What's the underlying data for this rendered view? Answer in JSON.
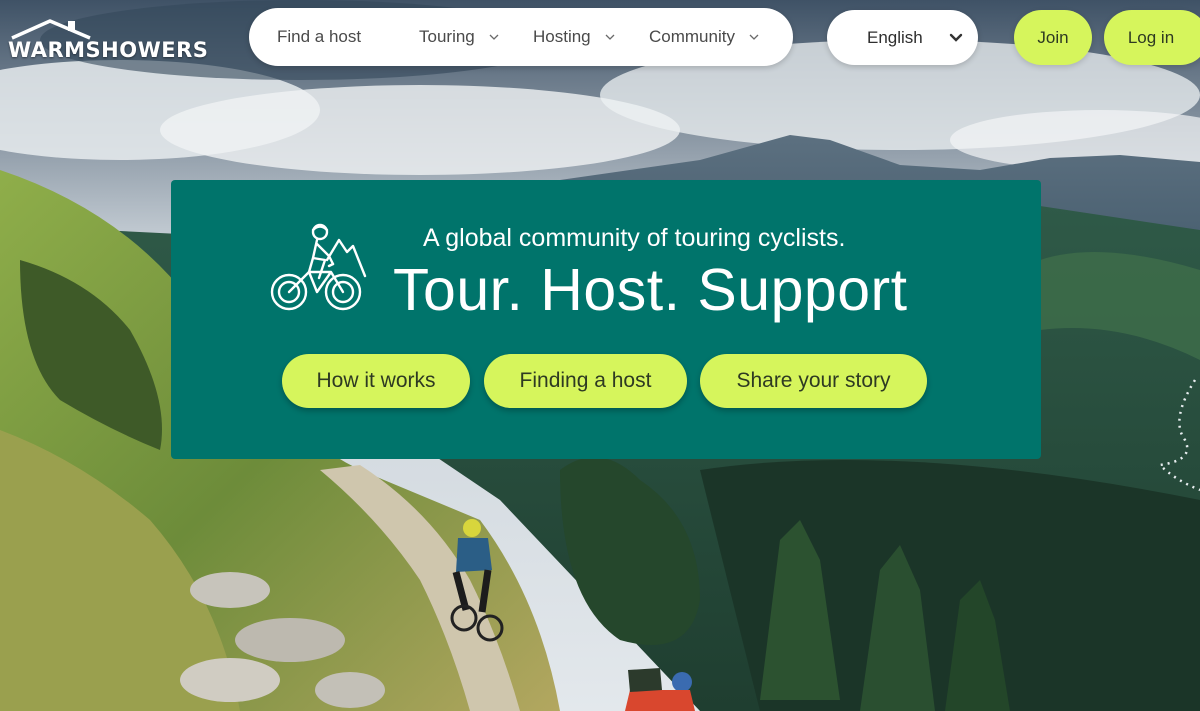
{
  "brand": {
    "logo_text": "WARMSHOWERS"
  },
  "nav": {
    "items": [
      {
        "label": "Find a host",
        "has_dropdown": false
      },
      {
        "label": "Touring",
        "has_dropdown": true
      },
      {
        "label": "Hosting",
        "has_dropdown": true
      },
      {
        "label": "Community",
        "has_dropdown": true
      }
    ],
    "language": "English",
    "join_label": "Join",
    "login_label": "Log in"
  },
  "hero": {
    "tagline": "A global community of touring cyclists.",
    "headline": "Tour. Host. Support",
    "buttons": [
      {
        "label": "How it works"
      },
      {
        "label": "Finding a host"
      },
      {
        "label": "Share your story"
      }
    ]
  },
  "icons": [
    "house-roof-icon",
    "chevron-down-icon",
    "cyclist-mountain-icon"
  ],
  "colors": {
    "hero_bg": "#00746b",
    "accent_lime": "#d6f55c",
    "nav_bg": "#ffffff",
    "text_dark": "#4a4a4a"
  }
}
